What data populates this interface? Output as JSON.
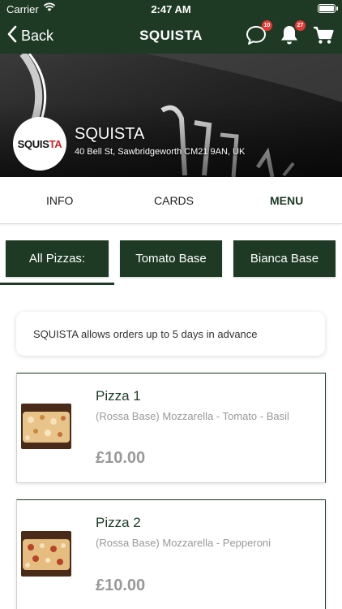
{
  "status_bar": {
    "carrier": "Carrier",
    "time": "2:47 AM"
  },
  "nav": {
    "back_label": "Back",
    "title": "SQUISTA",
    "chat_badge": "10",
    "notification_badge": "27",
    "icons": [
      "chevron-left-icon",
      "chat-icon",
      "bell-icon",
      "cart-icon"
    ]
  },
  "restaurant": {
    "logo_text_a": "SQUIS",
    "logo_text_b": "TA",
    "name": "SQUISTA",
    "address": "40 Bell St, Sawbridgeworth CM21 9AN, UK"
  },
  "tabs": [
    {
      "label": "INFO",
      "active": false
    },
    {
      "label": "CARDS",
      "active": false
    },
    {
      "label": "MENU",
      "active": true
    }
  ],
  "categories": [
    {
      "label": "All Pizzas:",
      "selected": true
    },
    {
      "label": "Tomato Base",
      "selected": false
    },
    {
      "label": "Bianca Base",
      "selected": false
    }
  ],
  "notice": "SQUISTA allows orders up to 5 days in advance",
  "products": [
    {
      "name": "Pizza 1",
      "description": "(Rossa Base) Mozzarella - Tomato - Basil",
      "price": "£10.00"
    },
    {
      "name": "Pizza 2",
      "description": "(Rossa Base) Mozzarella - Pepperoni",
      "price": "£10.00"
    }
  ],
  "colors": {
    "brand": "#1e3a24",
    "badge": "#e53935",
    "muted_text": "#999999"
  }
}
